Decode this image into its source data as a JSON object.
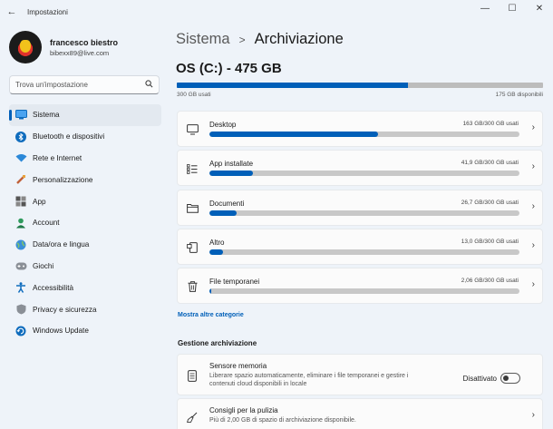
{
  "window": {
    "title": "Impostazioni",
    "controls": {
      "minimize": "—",
      "maximize": "☐",
      "close": "✕"
    }
  },
  "user": {
    "name": "francesco biestro",
    "email": "bibexx89@live.com"
  },
  "search": {
    "placeholder": "Trova un'impostazione"
  },
  "sidebar": {
    "items": [
      {
        "label": "Sistema",
        "icon": "system-icon",
        "active": true
      },
      {
        "label": "Bluetooth e dispositivi",
        "icon": "bluetooth-icon",
        "active": false
      },
      {
        "label": "Rete e Internet",
        "icon": "wifi-icon",
        "active": false
      },
      {
        "label": "Personalizzazione",
        "icon": "brush-icon",
        "active": false
      },
      {
        "label": "App",
        "icon": "apps-icon",
        "active": false
      },
      {
        "label": "Account",
        "icon": "account-icon",
        "active": false
      },
      {
        "label": "Data/ora e lingua",
        "icon": "globe-clock-icon",
        "active": false
      },
      {
        "label": "Giochi",
        "icon": "gamepad-icon",
        "active": false
      },
      {
        "label": "Accessibilità",
        "icon": "accessibility-icon",
        "active": false
      },
      {
        "label": "Privacy e sicurezza",
        "icon": "shield-icon",
        "active": false
      },
      {
        "label": "Windows Update",
        "icon": "update-icon",
        "active": false
      }
    ]
  },
  "breadcrumb": {
    "parent": "Sistema",
    "separator": ">",
    "current": "Archiviazione"
  },
  "drive": {
    "title": "OS (C:) - 475 GB",
    "used_label": "300 GB usati",
    "free_label": "175 GB disponibili",
    "used_fraction": 0.632
  },
  "categories": [
    {
      "name": "Desktop",
      "size": "163 GB/300 GB usati",
      "fraction": 0.543,
      "icon": "monitor-icon"
    },
    {
      "name": "App installate",
      "size": "41,9 GB/300 GB usati",
      "fraction": 0.14,
      "icon": "app-list-icon"
    },
    {
      "name": "Documenti",
      "size": "26,7 GB/300 GB usati",
      "fraction": 0.089,
      "icon": "folder-icon"
    },
    {
      "name": "Altro",
      "size": "13,0 GB/300 GB usati",
      "fraction": 0.043,
      "icon": "other-files-icon"
    },
    {
      "name": "File temporanei",
      "size": "2,06 GB/300 GB usati",
      "fraction": 0.007,
      "icon": "trash-icon"
    }
  ],
  "more_link": "Mostra altre categorie",
  "management": {
    "title": "Gestione archiviazione",
    "storage_sense": {
      "title": "Sensore memoria",
      "description": "Liberare spazio automaticamente, eliminare i file temporanei e gestire i contenuti cloud disponibili in locale",
      "toggle_label": "Disattivato",
      "enabled": false
    },
    "cleanup": {
      "title": "Consigli per la pulizia",
      "description": "Più di 2,00 GB di spazio di archiviazione disponibile."
    }
  },
  "colors": {
    "accent": "#005fb8",
    "background": "#eef3f9",
    "card": "#fbfbfb",
    "bar_track": "#c8c8c8"
  }
}
